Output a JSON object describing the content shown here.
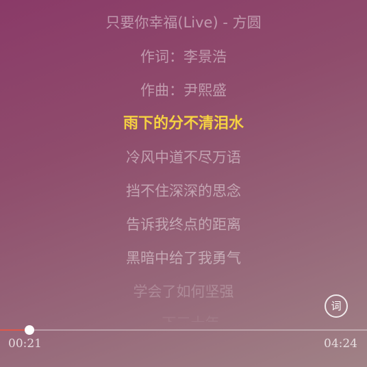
{
  "lyrics": {
    "lines": [
      "只要你幸福(Live) - 方圆",
      "作词：李景浩",
      "作曲：尹熙盛",
      "雨下的分不清泪水",
      "冷风中道不尽万语",
      "挡不住深深的思念",
      "告诉我终点的距离",
      "黑暗中给了我勇气",
      "学会了如何坚强",
      "一下三十年"
    ],
    "current_index": 3
  },
  "lyric_button": {
    "label": "词"
  },
  "player": {
    "elapsed": "00:21",
    "total": "04:24",
    "progress": 0.08
  },
  "colors": {
    "highlight": "#f5d142",
    "progress_fill": "#e0584a"
  }
}
